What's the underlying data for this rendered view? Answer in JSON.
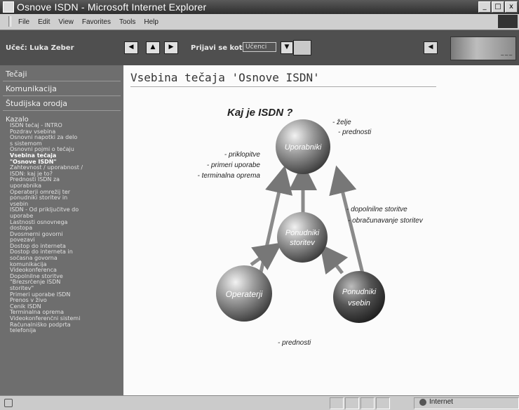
{
  "window": {
    "title": "Osnove ISDN - Microsoft Internet Explorer",
    "buttons": [
      "_",
      "□",
      "x"
    ]
  },
  "menubar": {
    "items": [
      "File",
      "Edit",
      "View",
      "Favorites",
      "Tools",
      "Help"
    ]
  },
  "header": {
    "user": "Učeč: Luka Zeber",
    "jump_label": "Prijavi se kot:",
    "jump_value": "Učenci"
  },
  "sidebar": {
    "nav": [
      "Tečaji",
      "Komunikacija",
      "Študijska orodja"
    ],
    "kazalo_label": "Kazalo",
    "toc": [
      "ISDN tečaj - INTRO",
      "Pozdrav vsebina",
      "Osnovni napotki za delo",
      "s sistemom",
      "Osnovni pojmi o tečaju",
      "Vsebina tečaja",
      "\"Osnove ISDN\"",
      "Zahtevnost / uporabnost /",
      "ISDN: kaj je to?",
      "Prednosti ISDN za",
      "uporabnika",
      "Operaterji omrežij ter",
      "ponudniki storitev in",
      "vsebin",
      "ISDN - Od priključitve do",
      "uporabe",
      "Lastnosti osnovnega",
      "dostopa",
      "Dvosmerni govorni",
      "povezavi",
      "Dostop do interneta",
      "Dostop do interneta in",
      "sočasna govorna",
      "komunikacija",
      "Videokonferenca",
      "Dopolnilne storitve",
      "\"Brezsrčenje ISDN",
      "storitev\"",
      "Primeri uporabe ISDN",
      "Prenos v živo",
      "Cenik ISDN",
      "Terminalna oprema",
      "Videokonferenčni sistemi",
      "Računalniško podprta",
      "telefonija"
    ],
    "current_index": 5
  },
  "content": {
    "page_title": "Vsebina tečaja 'Osnove ISDN'",
    "diagram": {
      "heading": "Kaj je ISDN ?",
      "nodes": {
        "users": "Uporabniki",
        "service_providers": [
          "Ponudniki",
          "storitev"
        ],
        "operators": "Operaterji",
        "content_providers": [
          "Ponudniki",
          "vsebin"
        ]
      },
      "labels": {
        "users_right": [
          "- želje",
          "- prednosti"
        ],
        "users_left": [
          "- priklopitve",
          "- primeri uporabe",
          "- terminalna oprema"
        ],
        "middle_right": [
          "- dopolnilne storitve",
          "- obračunavanje storitev"
        ],
        "bottom": "- prednosti"
      }
    }
  },
  "statusbar": {
    "zone": "Internet"
  }
}
